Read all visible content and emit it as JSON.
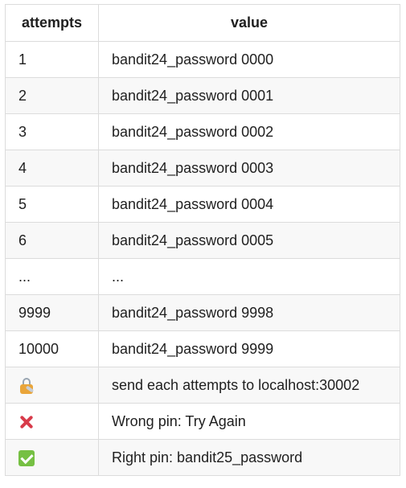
{
  "table": {
    "headers": [
      "attempts",
      "value"
    ],
    "rows": [
      {
        "attempt": "1",
        "value": "bandit24_password 0000"
      },
      {
        "attempt": "2",
        "value": "bandit24_password 0001"
      },
      {
        "attempt": "3",
        "value": "bandit24_password 0002"
      },
      {
        "attempt": "4",
        "value": "bandit24_password 0003"
      },
      {
        "attempt": "5",
        "value": "bandit24_password 0004"
      },
      {
        "attempt": "6",
        "value": "bandit24_password 0005"
      },
      {
        "attempt": "...",
        "value": "..."
      },
      {
        "attempt": "9999",
        "value": "bandit24_password 9998"
      },
      {
        "attempt": "10000",
        "value": "bandit24_password 9999"
      },
      {
        "icon": "lock-with-key-icon",
        "value": "send each attempts to localhost:30002"
      },
      {
        "icon": "cross-mark-icon",
        "value": "Wrong pin: Try Again"
      },
      {
        "icon": "check-mark-icon",
        "value": "Right pin: bandit25_password"
      }
    ]
  },
  "colors": {
    "border": "#dcdcdc",
    "alt_row": "#f8f8f8",
    "lock_body": "#e9a53a",
    "cross": "#d83b4a",
    "check": "#76c043"
  }
}
